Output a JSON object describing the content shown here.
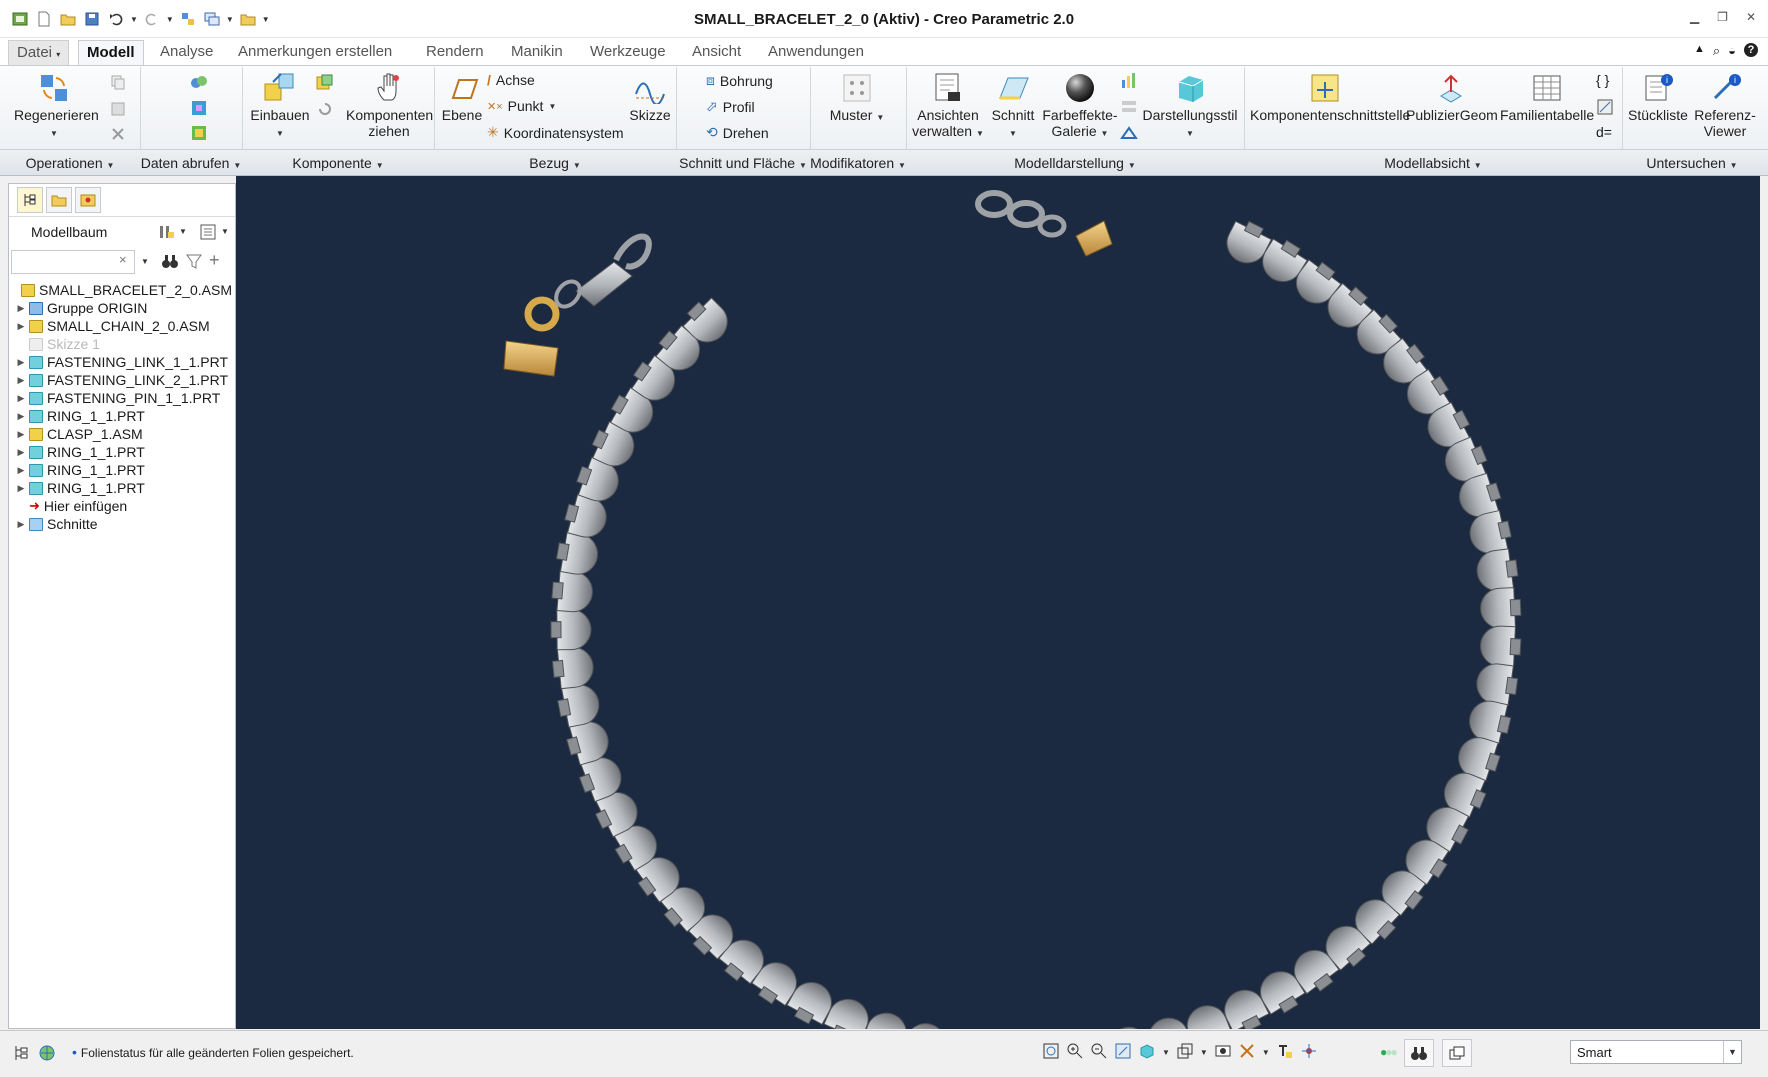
{
  "window": {
    "title": "SMALL_BRACELET_2_0 (Aktiv) - Creo Parametric 2.0"
  },
  "tabs": [
    "Datei",
    "Modell",
    "Analyse",
    "Anmerkungen erstellen",
    "Rendern",
    "Manikin",
    "Werkzeuge",
    "Ansicht",
    "Anwendungen"
  ],
  "active_tab": "Modell",
  "ribbon": {
    "regenerieren": "Regenerieren",
    "einbauen": "Einbauen",
    "komponenten_ziehen_1": "Komponenten",
    "komponenten_ziehen_2": "ziehen",
    "ebene": "Ebene",
    "achse": "Achse",
    "punkt": "Punkt",
    "koordinatensystem": "Koordinatensystem",
    "skizze": "Skizze",
    "bohrung": "Bohrung",
    "profil": "Profil",
    "drehen": "Drehen",
    "muster": "Muster",
    "ansichten_1": "Ansichten",
    "ansichten_2": "verwalten",
    "schnitt": "Schnitt",
    "farbeffekte_1": "Farbeffekte-",
    "farbeffekte_2": "Galerie",
    "darstellungsstil": "Darstellungsstil",
    "komponentenschnittstelle": "Komponentenschnittstelle",
    "publiziergeom": "PublizierGeom",
    "familientabelle": "Familientabelle",
    "stueckliste": "Stückliste",
    "referenz_1": "Referenz-",
    "referenz_2": "Viewer",
    "dgleich": "d="
  },
  "groups": [
    "Operationen",
    "Daten abrufen",
    "Komponente",
    "Bezug",
    "Schnitt und Fläche",
    "Modifikatoren",
    "Modelldarstellung",
    "Modellabsicht",
    "Untersuchen"
  ],
  "model_tree": {
    "header": "Modellbaum",
    "search_value": "",
    "clear": "×",
    "nodes": [
      {
        "label": "SMALL_BRACELET_2_0.ASM",
        "icon": "assembly-icon"
      },
      {
        "label": "Gruppe ORIGIN",
        "icon": "group-icon"
      },
      {
        "label": "SMALL_CHAIN_2_0.ASM",
        "icon": "assembly-icon"
      },
      {
        "label": "Skizze 1",
        "icon": "sketch-icon"
      },
      {
        "label": "FASTENING_LINK_1_1.PRT",
        "icon": "part-icon"
      },
      {
        "label": "FASTENING_LINK_2_1.PRT",
        "icon": "part-icon"
      },
      {
        "label": "FASTENING_PIN_1_1.PRT",
        "icon": "part-icon"
      },
      {
        "label": "RING_1_1.PRT",
        "icon": "part-icon"
      },
      {
        "label": "CLASP_1.ASM",
        "icon": "assembly-icon"
      },
      {
        "label": "RING_1_1.PRT",
        "icon": "part-icon"
      },
      {
        "label": "RING_1_1.PRT",
        "icon": "part-icon"
      },
      {
        "label": "RING_1_1.PRT",
        "icon": "part-icon"
      },
      {
        "label": "Hier einfügen",
        "icon": "insert-arrow-icon"
      },
      {
        "label": "Schnitte",
        "icon": "sections-icon"
      }
    ]
  },
  "status": {
    "message": "Folienstatus für alle geänderten Folien gespeichert.",
    "filter": "Smart"
  },
  "colors": {
    "viewport_bg": "#1b2a40",
    "link_silver": "#b9bcc0",
    "gold": "#d6a94a",
    "accent": "#1b59c4"
  }
}
